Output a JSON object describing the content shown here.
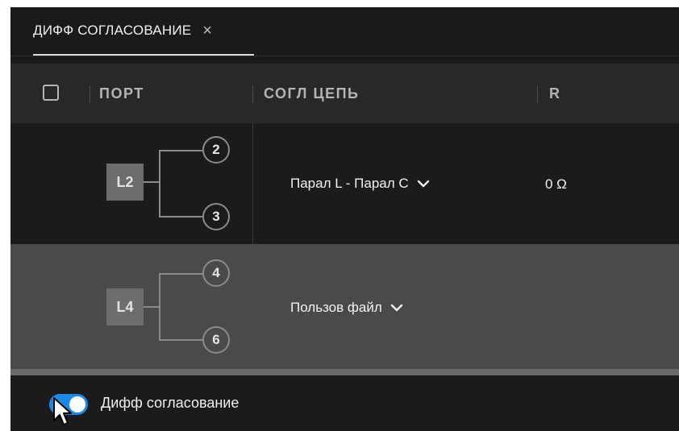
{
  "tab": {
    "label": "ДИФФ СОГЛАСОВАНИЕ",
    "close_icon": "×"
  },
  "table": {
    "headers": {
      "port": "ПОРТ",
      "circuit": "СОГЛ ЦЕПЬ",
      "r": "R"
    },
    "rows": [
      {
        "logical_port": "L2",
        "ports": [
          "2",
          "3"
        ],
        "circuit": "Парал L - Парал C",
        "r": "0 Ω"
      },
      {
        "logical_port": "L4",
        "ports": [
          "4",
          "6"
        ],
        "circuit": "Пользов файл",
        "r": ""
      }
    ]
  },
  "toggle": {
    "label": "Дифф согласование",
    "state": "on"
  },
  "colors": {
    "accent": "#1e88e5",
    "selected_row": "#4a4a4a",
    "background": "#1b1b1b"
  }
}
